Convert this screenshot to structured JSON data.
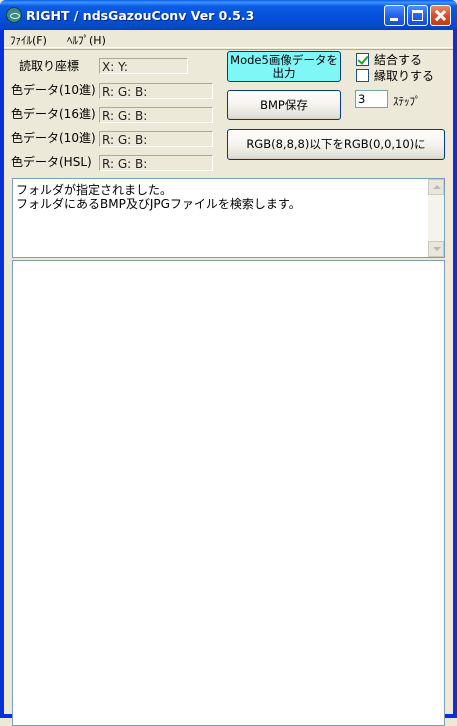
{
  "window": {
    "title": "RIGHT / ndsGazouConv Ver 0.5.3"
  },
  "menu": {
    "items": [
      {
        "label": "ﾌｧｲﾙ(F)"
      },
      {
        "label": "ﾍﾙﾌﾟ(H)"
      }
    ]
  },
  "readout": {
    "coord_label": "読取り座標",
    "coord_value": "X: Y:",
    "rows": [
      {
        "label": "色データ(10進)",
        "value": "R: G: B:"
      },
      {
        "label": "色データ(16進)",
        "value": "R: G: B:"
      },
      {
        "label": "色データ(10進)",
        "value": "R: G: B:"
      },
      {
        "label": "色データ(HSL)",
        "value": "R: G: B:"
      }
    ]
  },
  "buttons": {
    "mode5_line1": "Mode5画像データを",
    "mode5_line2": "出力",
    "bmp_save": "BMP保存",
    "rgb_convert": "RGB(8,8,8)以下をRGB(0,0,10)に"
  },
  "options": {
    "combine_label": "結合する",
    "combine_checked": true,
    "border_label": "縁取りする",
    "border_checked": false,
    "step_value": "3",
    "step_label": "ｽﾃｯﾌﾟ"
  },
  "log": {
    "lines": [
      "フォルダが指定されました。",
      "フォルダにあるBMP及びJPGファイルを検索します。"
    ]
  }
}
